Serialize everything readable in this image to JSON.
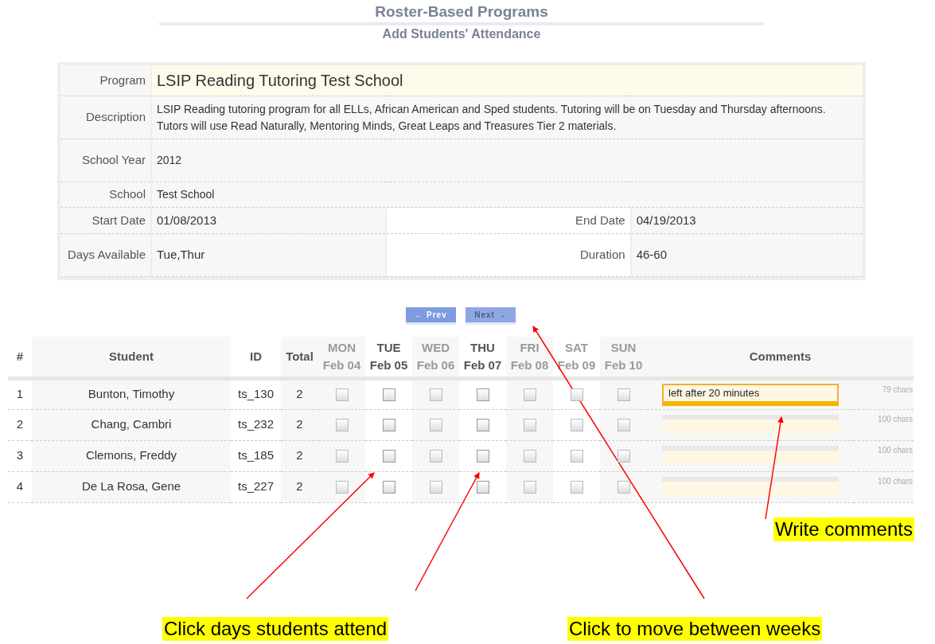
{
  "header": {
    "title": "Roster-Based Programs",
    "subtitle": "Add Students' Attendance"
  },
  "program_info": [
    {
      "label": "Program",
      "value": "LSIP Reading Tutoring Test School",
      "kind": "title"
    },
    {
      "label": "Description",
      "value": "LSIP Reading tutoring program for all ELLs, African American and Sped students. Tutoring will be on Tuesday and Thursday afternoons. Tutors will use Read Naturally, Mentoring Minds, Great Leaps and Treasures Tier 2 materials.",
      "kind": "text"
    },
    {
      "label": "School Year",
      "value": "2012",
      "kind": "text"
    },
    {
      "label": "School",
      "value": "Test School",
      "kind": "text"
    },
    {
      "label": "Start Date",
      "value": "01/08/2013",
      "kind": "pair",
      "label_2": "End Date",
      "value_2": "04/19/2013"
    },
    {
      "label": "Days Available",
      "value": "Tue,Thur",
      "kind": "pair",
      "label_2": "Duration",
      "value_2": "46-60"
    }
  ],
  "pager": [
    {
      "label": "← Prev",
      "disabled": false
    },
    {
      "label": "Next →",
      "disabled": true
    }
  ],
  "attendance": {
    "columns": [
      "#",
      "Student",
      "ID",
      "Total",
      "Comments"
    ],
    "days": [
      {
        "day": "MON",
        "date": "Feb 04",
        "enabled": false
      },
      {
        "day": "TUE",
        "date": "Feb 05",
        "enabled": true
      },
      {
        "day": "WED",
        "date": "Feb 06",
        "enabled": false
      },
      {
        "day": "THU",
        "date": "Feb 07",
        "enabled": true
      },
      {
        "day": "FRI",
        "date": "Feb 08",
        "enabled": false
      },
      {
        "day": "SAT",
        "date": "Feb 09",
        "enabled": false
      },
      {
        "day": "SUN",
        "date": "Feb 10",
        "enabled": false
      }
    ],
    "rows": [
      {
        "number": "1",
        "student": "Bunton, Timothy",
        "id": "ts_130",
        "total": "2",
        "checks": [
          false,
          false,
          false,
          false,
          false,
          false,
          false
        ],
        "comment": "left after 20 minutes",
        "focused": true,
        "chars_left": "79 chars"
      },
      {
        "number": "2",
        "student": "Chang, Cambri",
        "id": "ts_232",
        "total": "2",
        "checks": [
          false,
          false,
          false,
          false,
          false,
          false,
          false
        ],
        "focused": false,
        "chars_left": "100 chars"
      },
      {
        "number": "3",
        "student": "Clemons, Freddy",
        "id": "ts_185",
        "total": "2",
        "checks": [
          false,
          false,
          false,
          false,
          false,
          false,
          false
        ],
        "focused": false,
        "chars_left": "100 chars"
      },
      {
        "number": "4",
        "student": "De La Rosa, Gene",
        "id": "ts_227",
        "total": "2",
        "checks": [
          false,
          false,
          false,
          false,
          false,
          false,
          false
        ],
        "focused": false,
        "chars_left": "100 chars"
      }
    ]
  },
  "annotations": [
    {
      "text": "Write comments"
    },
    {
      "text": "Click days students attend"
    },
    {
      "text": "Click to move between weeks"
    }
  ]
}
